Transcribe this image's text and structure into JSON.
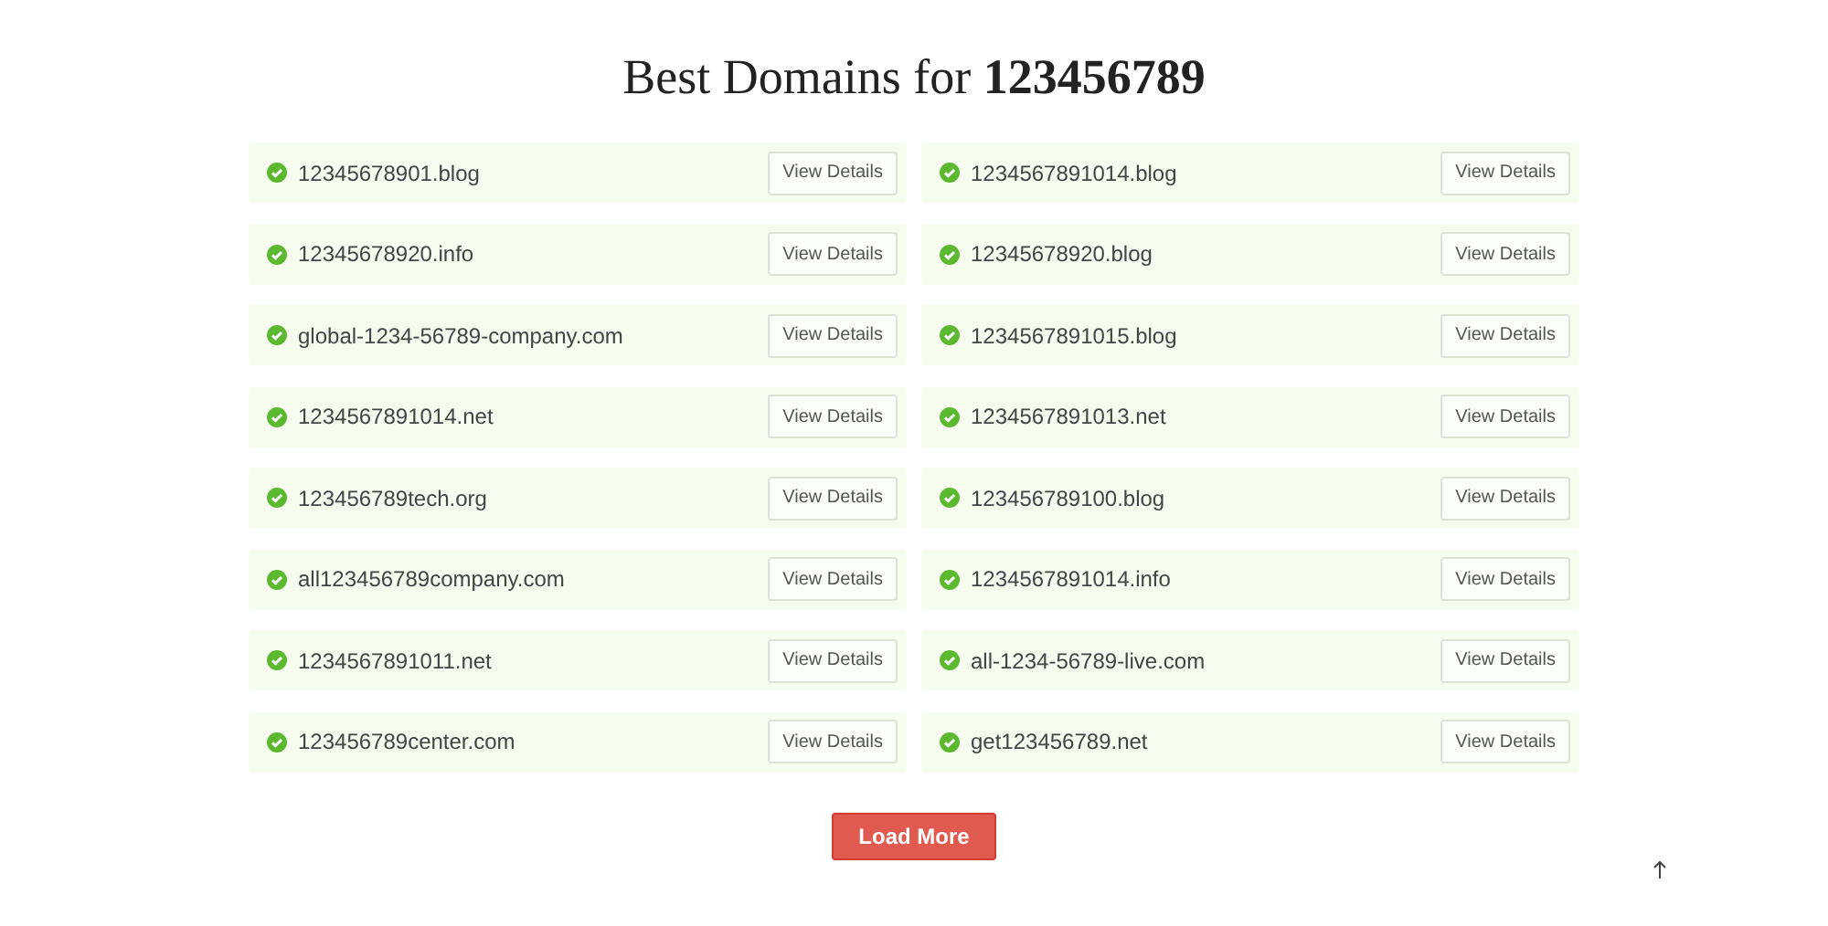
{
  "title": "Best Domains for **123456789**",
  "domains": [
    {
      "name": "12345678901.blog",
      "button": "View Details"
    },
    {
      "name": "1234567891014.blog",
      "button": "View Details"
    },
    {
      "name": "12345678920.info",
      "button": "View Details"
    },
    {
      "name": "12345678920.blog",
      "button": "View Details"
    },
    {
      "name": "global-1234-56789-company.com",
      "button": "View Details"
    },
    {
      "name": "1234567891015.blog",
      "button": "View Details"
    },
    {
      "name": "1234567891014.net",
      "button": "View Details"
    },
    {
      "name": "1234567891013.net",
      "button": "View Details"
    },
    {
      "name": "123456789tech.org",
      "button": "View Details"
    },
    {
      "name": "123456789100.blog",
      "button": "View Details"
    },
    {
      "name": "all123456789company.com",
      "button": "View Details"
    },
    {
      "name": "1234567891014.info",
      "button": "View Details"
    },
    {
      "name": "1234567891011.net",
      "button": "View Details"
    },
    {
      "name": "all-1234-56789-live.com",
      "button": "View Details"
    },
    {
      "name": "123456789center.com",
      "button": "View Details"
    },
    {
      "name": "get123456789.net",
      "button": "View Details"
    }
  ],
  "load_more": "Load More"
}
